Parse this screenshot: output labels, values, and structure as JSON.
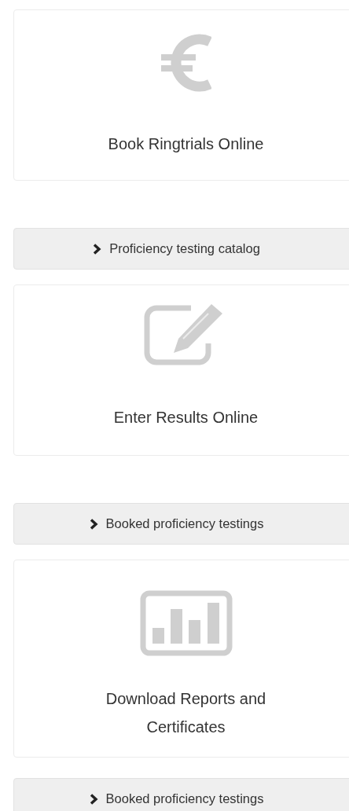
{
  "sections": [
    {
      "title": "Book Ringtrials Online",
      "link": "Proficiency testing catalog"
    },
    {
      "title": "Enter Results Online",
      "link": "Booked proficiency testings"
    },
    {
      "title": "Download Reports and Certificates",
      "link": "Booked proficiency testings"
    }
  ]
}
